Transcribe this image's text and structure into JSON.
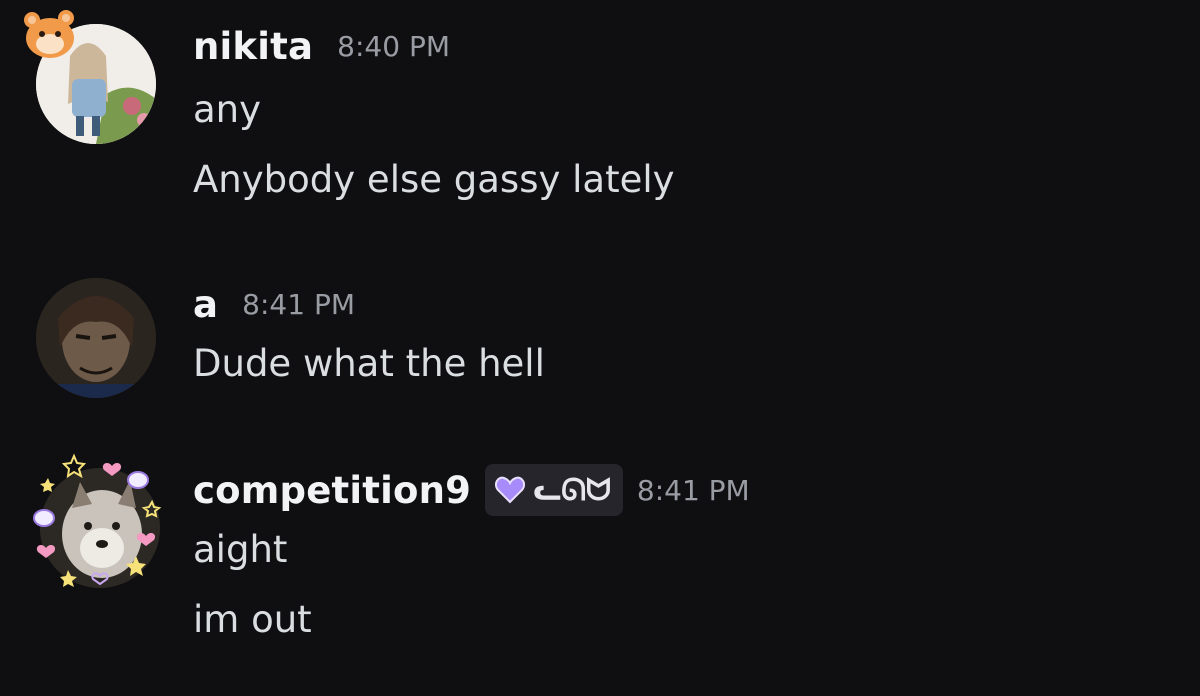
{
  "messages": [
    {
      "username": "nikita",
      "timestamp": "8:40 PM",
      "lines": [
        "any",
        "Anybody else gassy lately"
      ]
    },
    {
      "username": "a",
      "timestamp": "8:41 PM",
      "lines": [
        "Dude what the hell"
      ]
    },
    {
      "username": "competition9",
      "tag": {
        "text": "ᓚᘏᗢ",
        "icon": "purple-heart-icon",
        "color": "#a78bfa"
      },
      "timestamp": "8:41 PM",
      "lines": [
        "aight",
        "im out"
      ]
    }
  ],
  "colors": {
    "background": "#0f0f12",
    "username": "#f2f3f5",
    "timestamp": "#9a9ca3",
    "message_text": "#dbdee1",
    "tag_background": "#25252b"
  }
}
